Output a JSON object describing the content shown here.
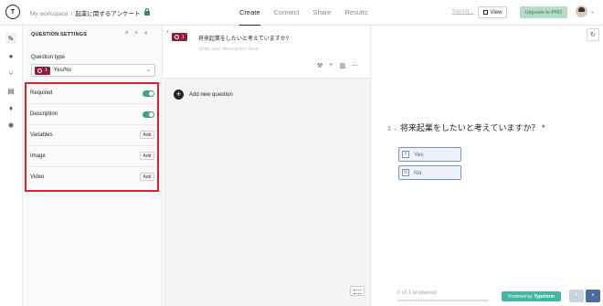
{
  "header": {
    "logo_letter": "T",
    "breadcrumb_workspace": "My workspace",
    "breadcrumb_sep": "/",
    "form_name": "起業に関するアンケート",
    "nav_tabs": [
      "Create",
      "Connect",
      "Share",
      "Results"
    ],
    "active_tab": "Create",
    "saving_text": "Saving...",
    "view_label": "View",
    "upgrade_label": "Upgrade to PRO"
  },
  "settings": {
    "title": "QUESTION SETTINGS",
    "question_type_label": "Question type",
    "question_type_number": "1",
    "question_type_value": "Yes/No",
    "rows": [
      {
        "label": "Required",
        "control": "switch",
        "on": true
      },
      {
        "label": "Description",
        "control": "switch",
        "on": true
      },
      {
        "label": "Variables",
        "control": "Add"
      },
      {
        "label": "Image",
        "control": "Add"
      },
      {
        "label": "Video",
        "control": "Add"
      }
    ]
  },
  "question_list": {
    "required_mark": "*",
    "number": "1",
    "title": "将来起業をしたいと考えていますか?",
    "description_placeholder": "Write your description here",
    "add_question_label": "Add new question"
  },
  "preview": {
    "question": "将来起業をしたいと考えていますか？",
    "required_mark": "*",
    "choices": [
      {
        "key": "Y",
        "label": "Yes"
      },
      {
        "key": "N",
        "label": "No"
      }
    ],
    "progress_text": "0 of 1 answered",
    "progress": 0,
    "powered_prefix": "Powered by",
    "powered_brand": "Typeform"
  },
  "colors": {
    "accent_red_box": "#d8232a",
    "badge": "#8c1f3a",
    "switch_on": "#3ea57a",
    "preview_blue": "#4a6d9c",
    "powered_teal": "#3fb7a5"
  }
}
